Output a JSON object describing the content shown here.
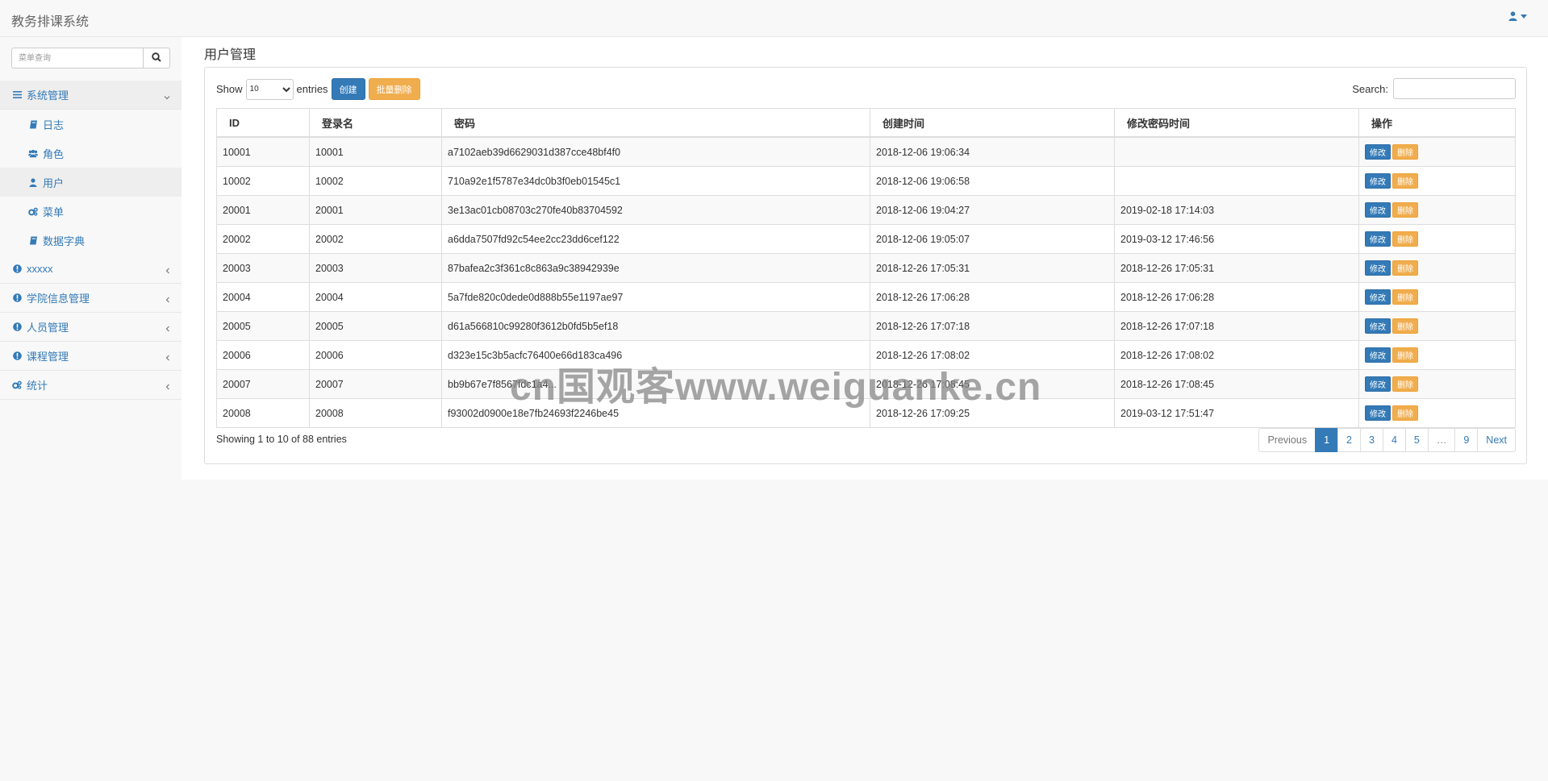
{
  "app": {
    "title": "教务排课系统"
  },
  "colors": {
    "primary": "#337ab7",
    "warning": "#f0ad4e",
    "sidebar_bg": "#f8f8f8",
    "border": "#dddddd"
  },
  "header": {
    "user_icon": "user-icon",
    "dropdown_icon": "caret-down-icon"
  },
  "sidebar": {
    "search_placeholder": "菜单查询",
    "search_icon": "search-icon",
    "menu": [
      {
        "label": "系统管理",
        "icon": "bars-icon",
        "expanded": true,
        "children": [
          {
            "label": "日志",
            "icon": "book-icon"
          },
          {
            "label": "角色",
            "icon": "users-icon"
          },
          {
            "label": "用户",
            "icon": "user-icon",
            "active": true
          },
          {
            "label": "菜单",
            "icon": "cogs-icon"
          },
          {
            "label": "数据字典",
            "icon": "book-icon"
          }
        ]
      },
      {
        "label": "xxxxx",
        "icon": "info-circle-icon"
      },
      {
        "label": "学院信息管理",
        "icon": "info-circle-icon"
      },
      {
        "label": "人员管理",
        "icon": "info-circle-icon"
      },
      {
        "label": "课程管理",
        "icon": "info-circle-icon"
      },
      {
        "label": "统计",
        "icon": "cogs-icon"
      }
    ]
  },
  "main": {
    "title": "用户管理",
    "toolbar": {
      "show_label": "Show",
      "entries_label": "entries",
      "page_size": "10",
      "create_label": "创建",
      "batch_delete_label": "批量删除",
      "search_label": "Search:",
      "search_value": ""
    },
    "table": {
      "columns": [
        "ID",
        "登录名",
        "密码",
        "创建时间",
        "修改密码时间",
        "操作"
      ],
      "edit_label": "修改",
      "delete_label": "删除",
      "rows": [
        {
          "id": "10001",
          "login": "10001",
          "password": "a7102aeb39d6629031d387cce48bf4f0",
          "created": "2018-12-06 19:06:34",
          "modified": ""
        },
        {
          "id": "10002",
          "login": "10002",
          "password": "710a92e1f5787e34dc0b3f0eb01545c1",
          "created": "2018-12-06 19:06:58",
          "modified": ""
        },
        {
          "id": "20001",
          "login": "20001",
          "password": "3e13ac01cb08703c270fe40b83704592",
          "created": "2018-12-06 19:04:27",
          "modified": "2019-02-18 17:14:03"
        },
        {
          "id": "20002",
          "login": "20002",
          "password": "a6dda7507fd92c54ee2cc23dd6cef122",
          "created": "2018-12-06 19:05:07",
          "modified": "2019-03-12 17:46:56"
        },
        {
          "id": "20003",
          "login": "20003",
          "password": "87bafea2c3f361c8c863a9c38942939e",
          "created": "2018-12-26 17:05:31",
          "modified": "2018-12-26 17:05:31"
        },
        {
          "id": "20004",
          "login": "20004",
          "password": "5a7fde820c0dede0d888b55e1197ae97",
          "created": "2018-12-26 17:06:28",
          "modified": "2018-12-26 17:06:28"
        },
        {
          "id": "20005",
          "login": "20005",
          "password": "d61a566810c99280f3612b0fd5b5ef18",
          "created": "2018-12-26 17:07:18",
          "modified": "2018-12-26 17:07:18"
        },
        {
          "id": "20006",
          "login": "20006",
          "password": "d323e15c3b5acfc76400e66d183ca496",
          "created": "2018-12-26 17:08:02",
          "modified": "2018-12-26 17:08:02"
        },
        {
          "id": "20007",
          "login": "20007",
          "password": "bb9b67e7f8567fdc1a4...",
          "created": "2018-12-26 17:08:45",
          "modified": "2018-12-26 17:08:45"
        },
        {
          "id": "20008",
          "login": "20008",
          "password": "f93002d0900e18e7fb24693f2246be45",
          "created": "2018-12-26 17:09:25",
          "modified": "2019-03-12 17:51:47"
        }
      ]
    },
    "info": "Showing 1 to 10 of 88 entries",
    "pagination": [
      "Previous",
      "1",
      "2",
      "3",
      "4",
      "5",
      "…",
      "9",
      "Next"
    ],
    "current_page": "1"
  },
  "watermark": "cn国观客www.weiguanke.cn"
}
